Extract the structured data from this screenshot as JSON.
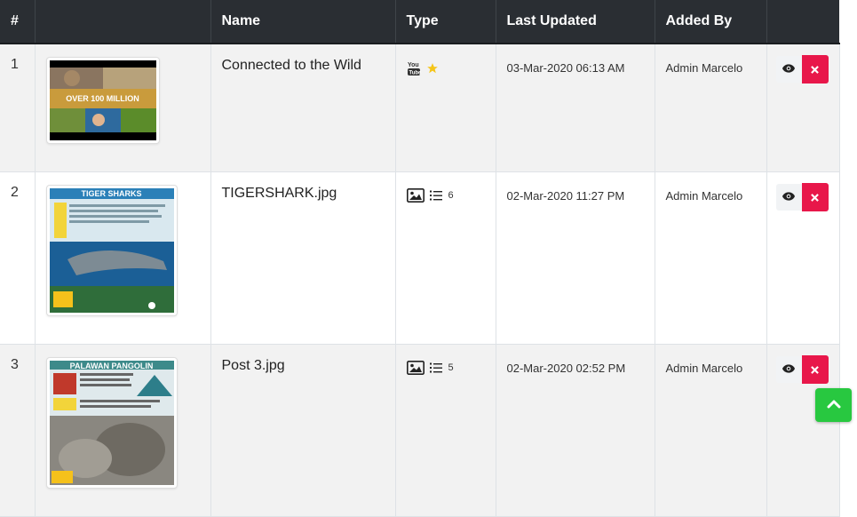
{
  "table": {
    "headers": {
      "num": "#",
      "thumb": "",
      "name": "Name",
      "type": "Type",
      "updated": "Last Updated",
      "added_by": "Added By",
      "actions": ""
    },
    "rows": [
      {
        "num": "1",
        "name": "Connected to the Wild",
        "type_icons": [
          "youtube-icon",
          "star-icon"
        ],
        "count": "",
        "updated": "03-Mar-2020 06:13 AM",
        "added_by": "Admin Marcelo",
        "thumb_text": "OVER 100 MILLION"
      },
      {
        "num": "2",
        "name": "TIGERSHARK.jpg",
        "type_icons": [
          "image-icon",
          "list-icon"
        ],
        "count": "6",
        "updated": "02-Mar-2020 11:27 PM",
        "added_by": "Admin Marcelo",
        "thumb_text": "TIGER SHARKS"
      },
      {
        "num": "3",
        "name": "Post 3.jpg",
        "type_icons": [
          "image-icon",
          "list-icon"
        ],
        "count": "5",
        "updated": "02-Mar-2020 02:52 PM",
        "added_by": "Admin Marcelo",
        "thumb_text": "PALAWAN PANGOLIN"
      }
    ]
  },
  "colors": {
    "header_bg": "#2a2e33",
    "delete": "#e8174a",
    "scroll_top": "#28c840",
    "star": "#f5c518"
  }
}
